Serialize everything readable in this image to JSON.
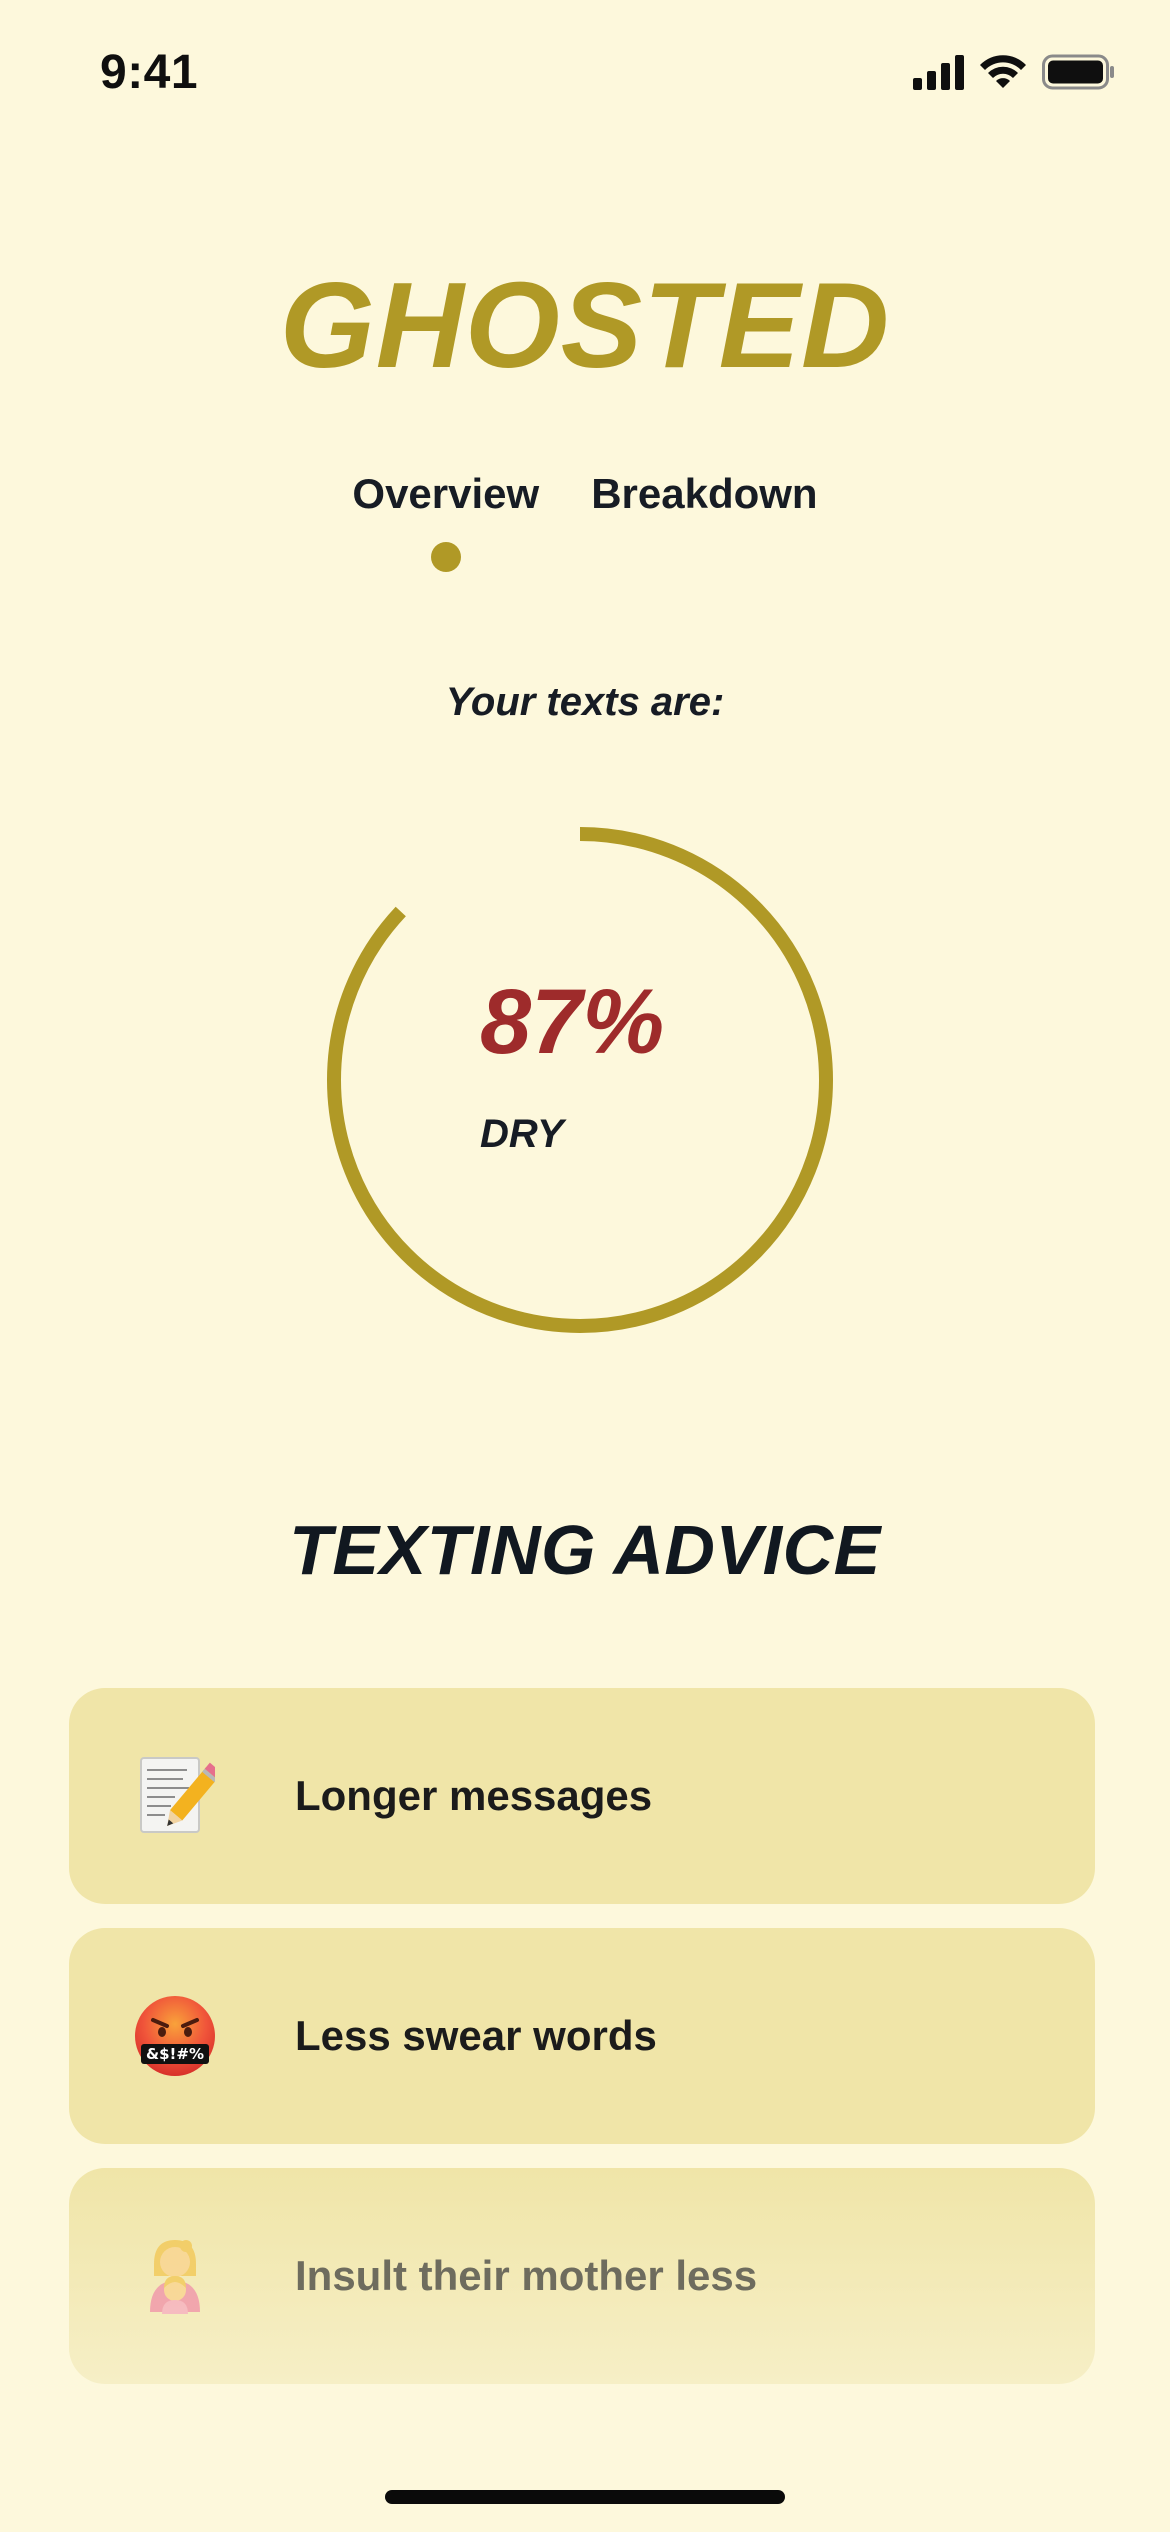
{
  "status_bar": {
    "time": "9:41",
    "icons": [
      "cellular-signal-icon",
      "wifi-icon",
      "battery-icon"
    ]
  },
  "app": {
    "title": "GHOSTED"
  },
  "tabs": [
    {
      "label": "Overview",
      "active": true
    },
    {
      "label": "Breakdown",
      "active": false
    }
  ],
  "summary": {
    "subtitle": "Your texts are:",
    "value_text": "87%",
    "value_fraction": 0.87,
    "label": "DRY"
  },
  "advice": {
    "title": "TEXTING ADVICE",
    "items": [
      {
        "icon": "memo-pencil-icon",
        "label": "Longer messages"
      },
      {
        "icon": "swearing-face-icon",
        "label": "Less swear words"
      },
      {
        "icon": "mother-daughter-icon",
        "label": "Insult their mother less"
      }
    ]
  },
  "colors": {
    "background": "#fdf8dc",
    "accent": "#b09926",
    "percentage": "#9e2b2b",
    "card": "#f0e5a8",
    "text": "#171c24"
  }
}
